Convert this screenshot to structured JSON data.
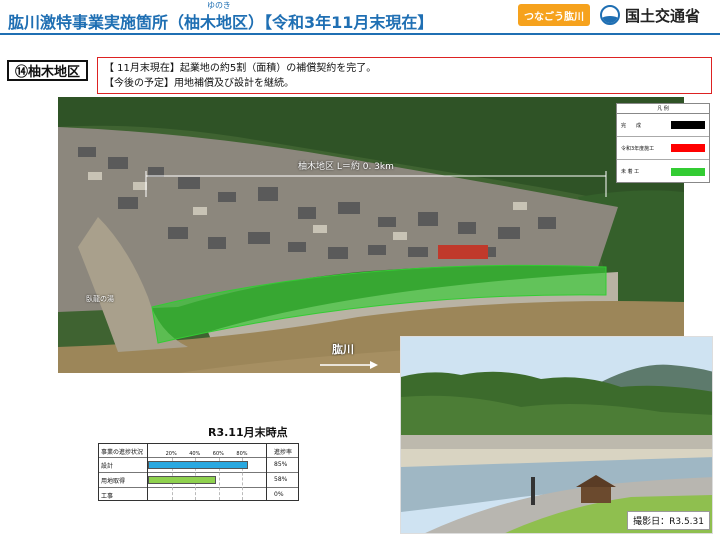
{
  "header": {
    "title": "肱川激特事業実施箇所（柚木地区）【令和3年11月末現在】",
    "ruby": "ゆのき",
    "logo_badge": "つなごう肱川",
    "ministry": "国土交通省"
  },
  "area_label": "⑭柚木地区",
  "info": {
    "line1": "【 11月末現在】起業地の約5割（面積）の補償契約を完了。",
    "line2": "【今後の予定】用地補償及び設計を継続。"
  },
  "aerial": {
    "length_label": "柚木地区 L＝約 0. 3km",
    "river_label": "肱川",
    "temple_label": "臥龍の湯"
  },
  "legend": {
    "title": "凡 例",
    "items": [
      {
        "label": "完　　成",
        "color": "#000000"
      },
      {
        "label": "令和3年度施工",
        "color": "#ff0000"
      },
      {
        "label": "未 着 工",
        "color": "#33cc33"
      }
    ]
  },
  "photo_date": "撮影日：R3.5.31",
  "chart_data": {
    "type": "bar",
    "title": "R3.11月末時点",
    "header_label": "事業の進捗状況",
    "rate_header": "進捗率",
    "ticks": [
      "20%",
      "40%",
      "60%",
      "80%"
    ],
    "categories": [
      "設計",
      "用地取得",
      "工事"
    ],
    "values": [
      85,
      58,
      0
    ],
    "value_labels": [
      "85%",
      "58%",
      "0%"
    ],
    "colors": [
      "#29a8e0",
      "#8fd14f",
      "#ffffff"
    ],
    "xlim": [
      0,
      100
    ]
  }
}
